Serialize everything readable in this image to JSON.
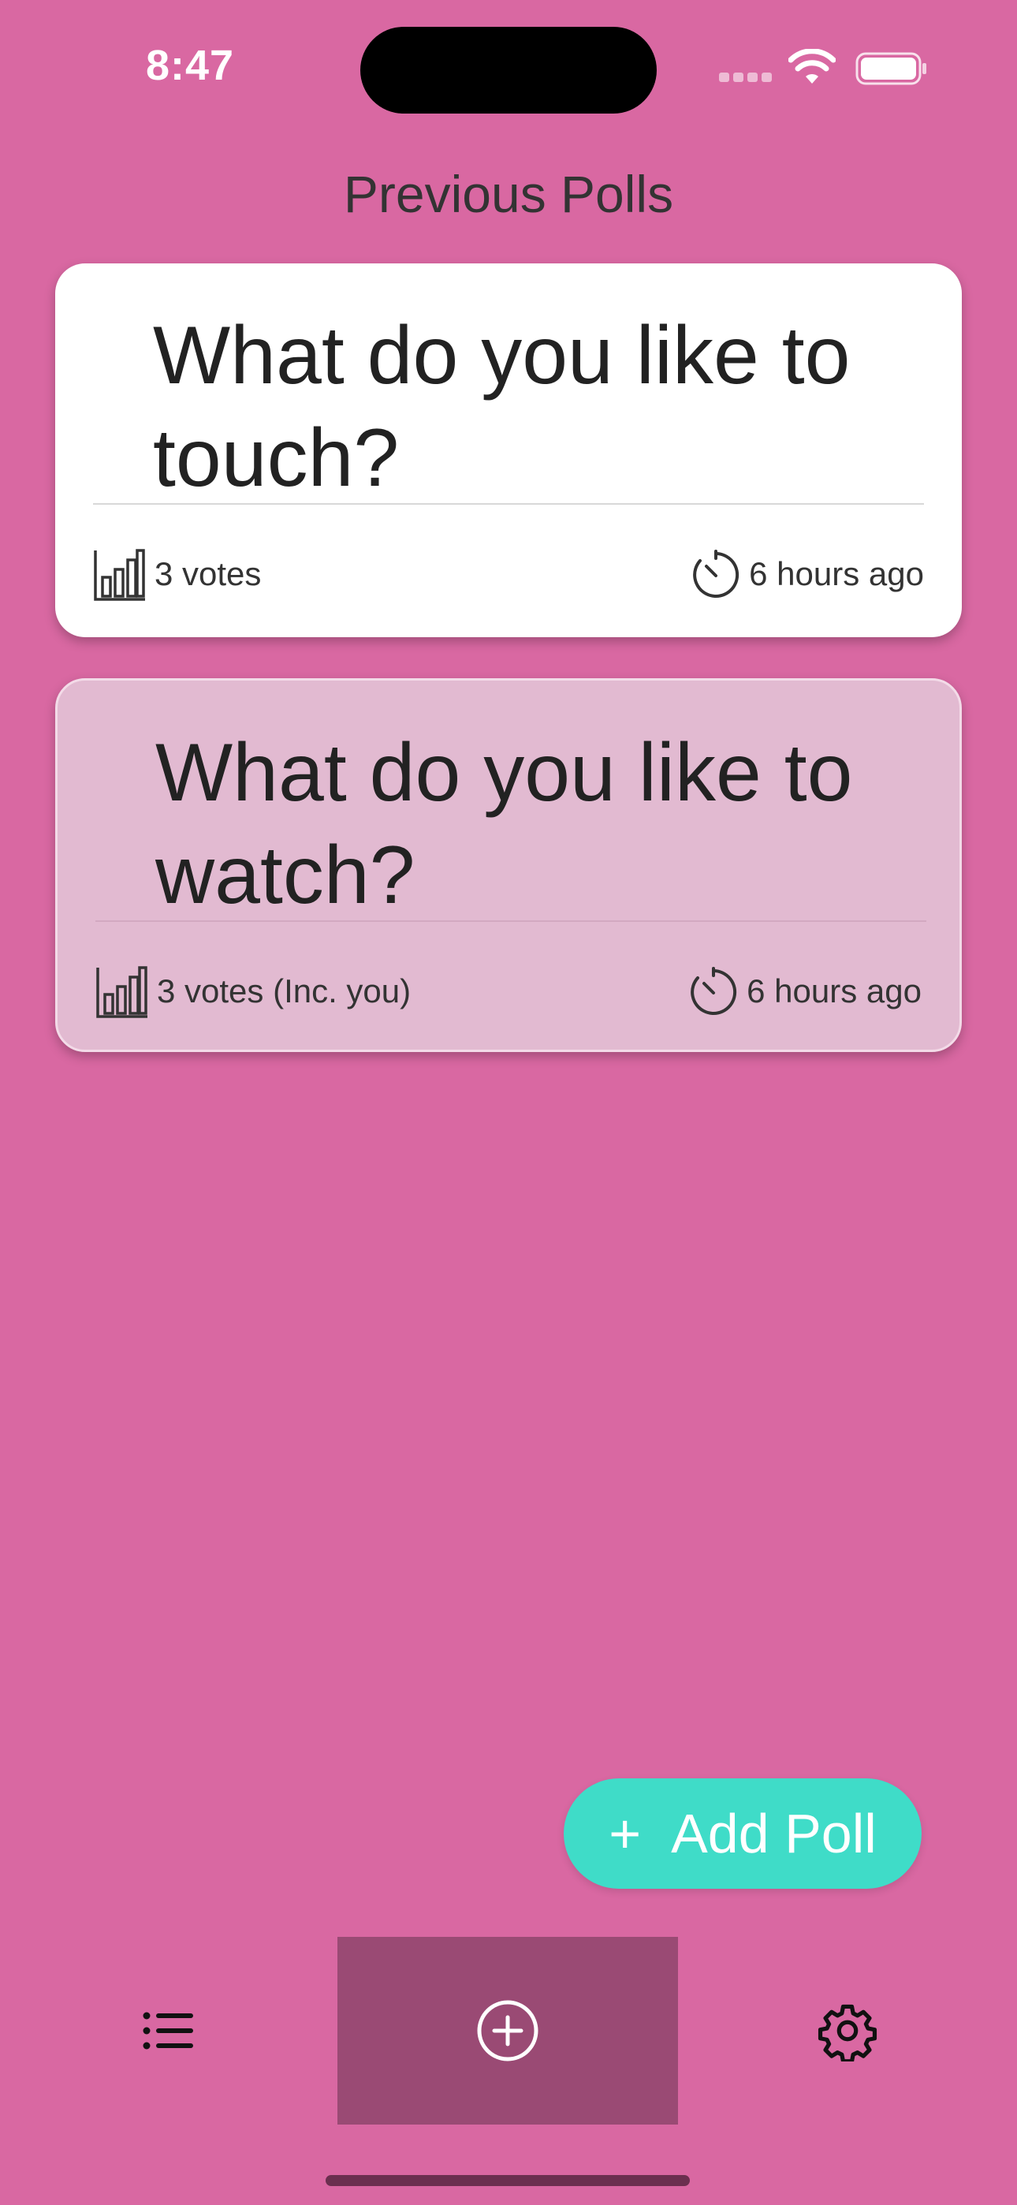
{
  "status_bar": {
    "time": "8:47"
  },
  "header": {
    "title": "Previous Polls"
  },
  "polls": [
    {
      "question": "What do you like to touch?",
      "votes": "3 votes",
      "time_ago": "6 hours ago",
      "voted": false
    },
    {
      "question": "What do you like to watch?",
      "votes": "3 votes (Inc. you)",
      "time_ago": "6 hours ago",
      "voted": true
    }
  ],
  "fab": {
    "icon": "plus-icon",
    "label": "Add Poll"
  },
  "tab_bar": {
    "items": [
      {
        "name": "list",
        "icon": "list-icon",
        "selected": false
      },
      {
        "name": "add",
        "icon": "add-circle-icon",
        "selected": true
      },
      {
        "name": "settings",
        "icon": "gear-icon",
        "selected": false
      }
    ]
  },
  "colors": {
    "background": "#d968a2",
    "card": "#ffffff",
    "card_voted": "#e2bad1",
    "fab": "#3fdcc8",
    "tab_selected": "#9a4a74"
  }
}
